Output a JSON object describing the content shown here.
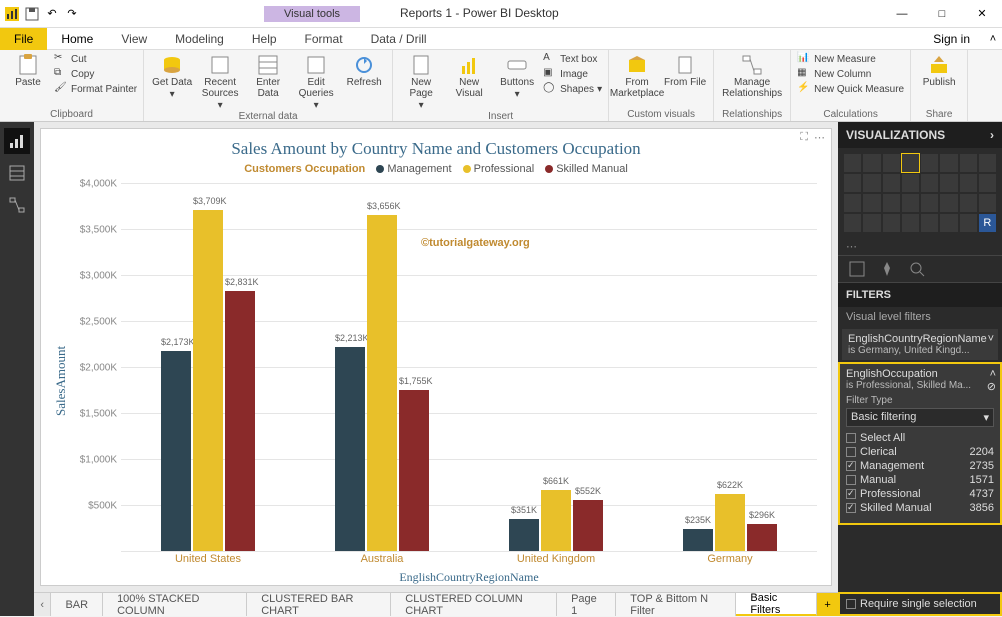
{
  "app": {
    "title": "Reports 1 - Power BI Desktop",
    "visualTools": "Visual tools",
    "signIn": "Sign in"
  },
  "tabs": {
    "file": "File",
    "home": "Home",
    "view": "View",
    "modeling": "Modeling",
    "help": "Help",
    "format": "Format",
    "dataDrill": "Data / Drill"
  },
  "ribbon": {
    "clipboard": {
      "label": "Clipboard",
      "paste": "Paste",
      "cut": "Cut",
      "copy": "Copy",
      "formatPainter": "Format Painter"
    },
    "external": {
      "label": "External data",
      "getData": "Get Data",
      "recent": "Recent Sources",
      "enter": "Enter Data",
      "edit": "Edit Queries",
      "refresh": "Refresh"
    },
    "insert": {
      "label": "Insert",
      "newPage": "New Page",
      "newVisual": "New Visual",
      "buttons": "Buttons",
      "textbox": "Text box",
      "image": "Image",
      "shapes": "Shapes"
    },
    "custom": {
      "label": "Custom visuals",
      "market": "From Marketplace",
      "file": "From File"
    },
    "rel": {
      "label": "Relationships",
      "manage": "Manage Relationships"
    },
    "calc": {
      "label": "Calculations",
      "newMeasure": "New Measure",
      "newColumn": "New Column",
      "newQuick": "New Quick Measure"
    },
    "share": {
      "label": "Share",
      "publish": "Publish"
    }
  },
  "chart": {
    "title": "Sales Amount by Country Name and Customers Occupation",
    "legendName": "Customers Occupation",
    "series": {
      "m": "Management",
      "p": "Professional",
      "s": "Skilled Manual"
    },
    "yLabel": "SalesAmount",
    "xLabel": "EnglishCountryRegionName",
    "watermark": "©tutorialgateway.org",
    "yTicks": [
      "$4,000K",
      "$3,500K",
      "$3,000K",
      "$2,500K",
      "$2,000K",
      "$1,500K",
      "$1,000K",
      "$500K"
    ]
  },
  "chart_data": {
    "type": "bar",
    "title": "Sales Amount by Country Name and Customers Occupation",
    "xlabel": "EnglishCountryRegionName",
    "ylabel": "SalesAmount",
    "ylim": [
      0,
      4000000
    ],
    "categories": [
      "United States",
      "Australia",
      "United Kingdom",
      "Germany"
    ],
    "series": [
      {
        "name": "Management",
        "values": [
          2173000,
          2213000,
          351000,
          235000
        ],
        "labels": [
          "$2,173K",
          "$2,213K",
          "$351K",
          "$235K"
        ]
      },
      {
        "name": "Professional",
        "values": [
          3709000,
          3656000,
          661000,
          622000
        ],
        "labels": [
          "$3,709K",
          "$3,656K",
          "$661K",
          "$622K"
        ]
      },
      {
        "name": "Skilled Manual",
        "values": [
          2831000,
          1755000,
          552000,
          296000
        ],
        "labels": [
          "$2,831K",
          "$1,755K",
          "$552K",
          "$296K"
        ]
      }
    ]
  },
  "pageTabs": {
    "bar": "BAR",
    "stacked": "100% STACKED COLUMN",
    "clusBar": "CLUSTERED BAR CHART",
    "clusCol": "CLUSTERED COLUMN CHART",
    "page1": "Page 1",
    "topN": "TOP & Bittom N Filter",
    "basic": "Basic Filters"
  },
  "right": {
    "viz": "VISUALIZATIONS",
    "filters": "FILTERS",
    "visualLevel": "Visual level filters",
    "card1": {
      "name": "EnglishCountryRegionName",
      "sub": "is Germany, United Kingd..."
    },
    "card2": {
      "name": "EnglishOccupation",
      "sub": "is Professional, Skilled Ma...",
      "filterType": "Filter Type",
      "basic": "Basic filtering"
    },
    "options": {
      "selectAll": "Select All",
      "clerical": "Clerical",
      "management": "Management",
      "manual": "Manual",
      "professional": "Professional",
      "skilled": "Skilled Manual"
    },
    "counts": {
      "clerical": "2204",
      "management": "2735",
      "manual": "1571",
      "professional": "4737",
      "skilled": "3856"
    },
    "require": "Require single selection"
  }
}
